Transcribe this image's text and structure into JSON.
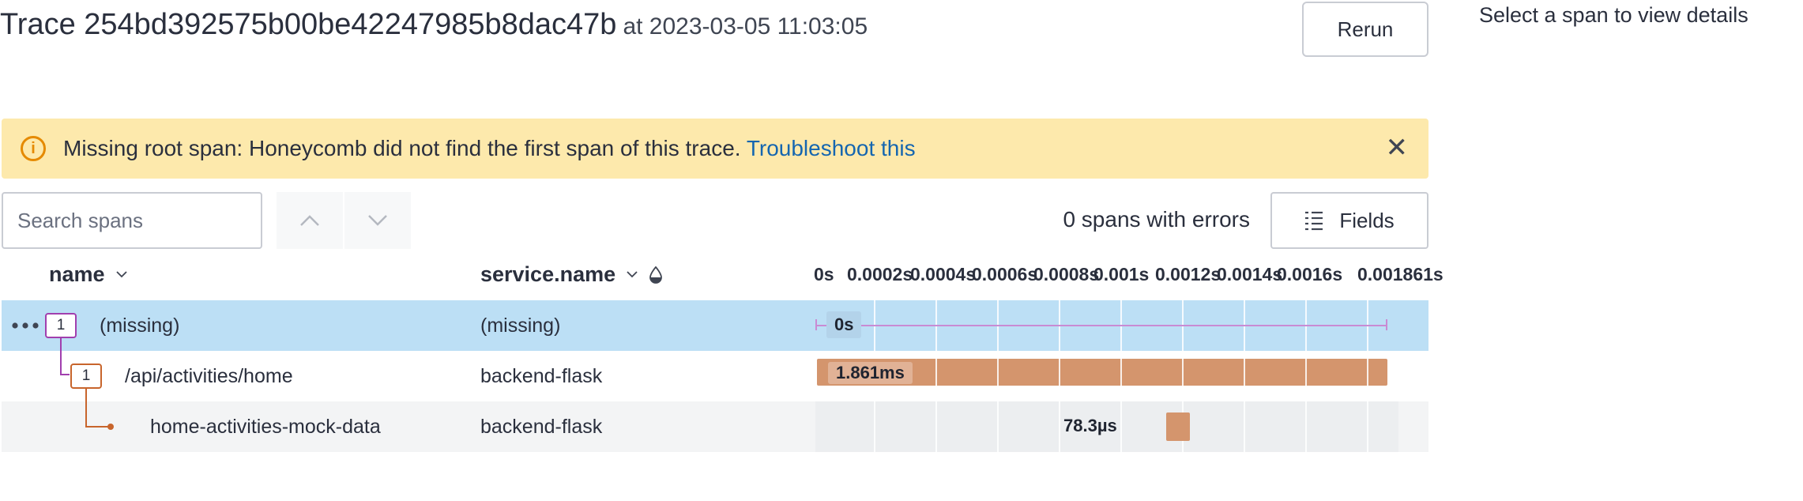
{
  "header": {
    "title": "Trace 254bd392575b00be42247985b8dac47b",
    "timestamp": "at 2023-03-05 11:03:05",
    "rerun_label": "Rerun",
    "detail_hint": "Select a span to view details"
  },
  "banner": {
    "message": "Missing root span: Honeycomb did not find the first span of this trace.",
    "link_text": "Troubleshoot this",
    "icon": "info-icon",
    "close_icon": "close-icon",
    "background": "#fde9ac",
    "accent": "#e58a00"
  },
  "toolbar": {
    "search_placeholder": "Search spans",
    "prev_icon": "chevron-up-icon",
    "next_icon": "chevron-down-icon",
    "errors_text": "0 spans with errors",
    "fields_label": "Fields",
    "fields_icon": "list-icon"
  },
  "columns": {
    "name": "name",
    "service": "service.name",
    "ticks": [
      "0s",
      "0.0002s",
      "0.0004s",
      "0.0006s",
      "0.0008s",
      "0.001s",
      "0.0012s",
      "0.0014s",
      "0.0016s",
      "0.001861s"
    ]
  },
  "rows": [
    {
      "name": "(missing)",
      "service": "(missing)",
      "count": "1",
      "duration_label": "0s",
      "selected": true
    },
    {
      "name": "/api/activities/home",
      "service": "backend-flask",
      "count": "1",
      "duration_label": "1.861ms",
      "selected": false
    },
    {
      "name": "home-activities-mock-data",
      "service": "backend-flask",
      "count": "",
      "duration_label": "78.3µs",
      "selected": false
    }
  ],
  "colors": {
    "selected_row": "#bcdff5",
    "span_bar": "#d4956d",
    "tree_line": "#c8652c",
    "root_tree_line": "#a13fae",
    "link": "#1566b0"
  }
}
